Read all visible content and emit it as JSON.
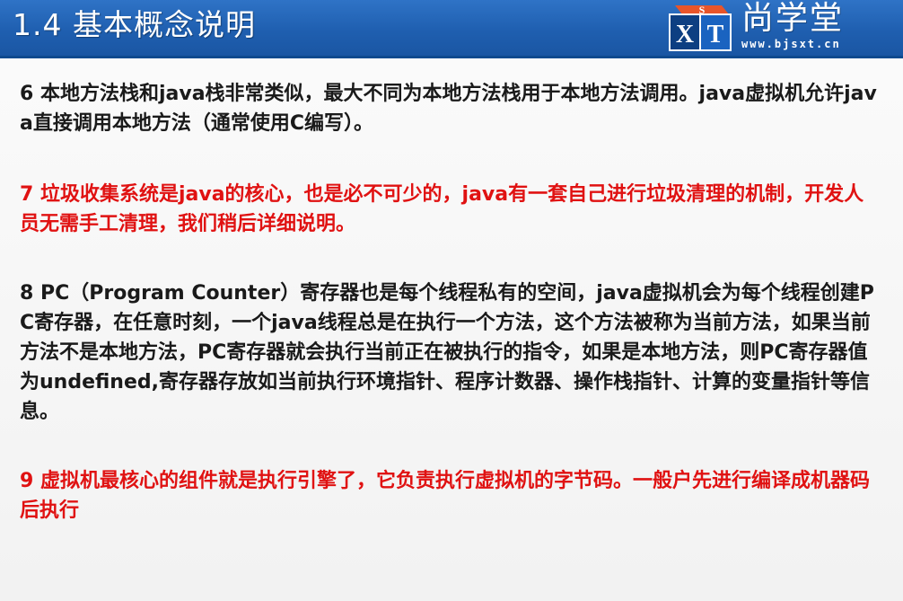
{
  "slide": {
    "title": "1.4 基本概念说明",
    "logo": {
      "mark_letters": "SXT",
      "name": "尚学堂",
      "url": "www.bjsxt.cn"
    },
    "colors": {
      "header_blue": "#1f5fb0",
      "body_text": "#1a1a1a",
      "highlight_red": "#e01212"
    },
    "paragraphs": [
      {
        "text": "6 本地方法栈和java栈非常类似，最大不同为本地方法栈用于本地方法调用。java虚拟机允许java直接调用本地方法（通常使用C编写）。",
        "color": "black"
      },
      {
        "text": "7 垃圾收集系统是java的核心，也是必不可少的，java有一套自己进行垃圾清理的机制，开发人员无需手工清理，我们稍后详细说明。",
        "color": "red"
      },
      {
        "text": "8 PC（Program Counter）寄存器也是每个线程私有的空间，java虚拟机会为每个线程创建PC寄存器，在任意时刻，一个java线程总是在执行一个方法，这个方法被称为当前方法，如果当前方法不是本地方法，PC寄存器就会执行当前正在被执行的指令，如果是本地方法，则PC寄存器值为undefined,寄存器存放如当前执行环境指针、程序计数器、操作栈指针、计算的变量指针等信息。",
        "color": "black"
      },
      {
        "text": "9 虚拟机最核心的组件就是执行引擎了，它负责执行虚拟机的字节码。一般户先进行编译成机器码后执行",
        "color": "red"
      }
    ]
  }
}
